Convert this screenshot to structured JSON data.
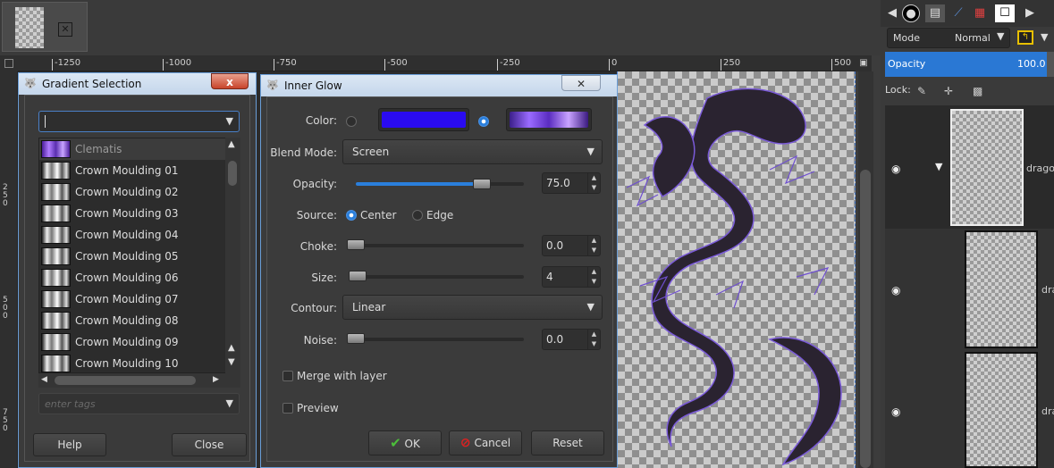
{
  "image_tab": {
    "close_icon": "close-icon"
  },
  "ruler": {
    "h_ticks": [
      "-1250",
      "-1000",
      "-750",
      "-500",
      "-250",
      "0",
      "250",
      "500"
    ],
    "v_ticks": [
      "2\n5\n0",
      "5\n0\n0",
      "7\n5\n0"
    ]
  },
  "dock": {
    "mode_label": "Mode",
    "mode_value": "Normal",
    "opacity_label": "Opacity",
    "opacity_value": "100.0",
    "lock_label": "Lock:",
    "layers": [
      {
        "name": "dragon"
      },
      {
        "name": "dra"
      },
      {
        "name": "dra"
      }
    ]
  },
  "gradient_selection": {
    "title": "Gradient Selection",
    "close_label": "x",
    "filter_value": "",
    "items": [
      "Clematis",
      "Crown Moulding 01",
      "Crown Moulding 02",
      "Crown Moulding 03",
      "Crown Moulding 04",
      "Crown Moulding 05",
      "Crown Moulding 06",
      "Crown Moulding 07",
      "Crown Moulding 08",
      "Crown Moulding 09",
      "Crown Moulding 10"
    ],
    "tags_placeholder": "enter tags",
    "help_label": "Help",
    "close_button_label": "Close"
  },
  "inner_glow": {
    "title": "Inner Glow",
    "color_label": "Color:",
    "solid_color": "#2a0bf0",
    "gradient_colors": [
      "#3b1f8a",
      "#9a6bff",
      "#5a2cc0",
      "#c9a3ff",
      "#3a1a80"
    ],
    "blend_mode_label": "Blend Mode:",
    "blend_mode_value": "Screen",
    "opacity_label": "Opacity:",
    "opacity_value": "75.0",
    "opacity_level": 0.75,
    "source_label": "Source:",
    "source_center": "Center",
    "source_edge": "Edge",
    "choke_label": "Choke:",
    "choke_value": "0.0",
    "size_label": "Size:",
    "size_value": "4",
    "contour_label": "Contour:",
    "contour_value": "Linear",
    "noise_label": "Noise:",
    "noise_value": "0.0",
    "merge_label": "Merge with layer",
    "preview_label": "Preview",
    "ok_label": "OK",
    "cancel_label": "Cancel",
    "reset_label": "Reset"
  }
}
